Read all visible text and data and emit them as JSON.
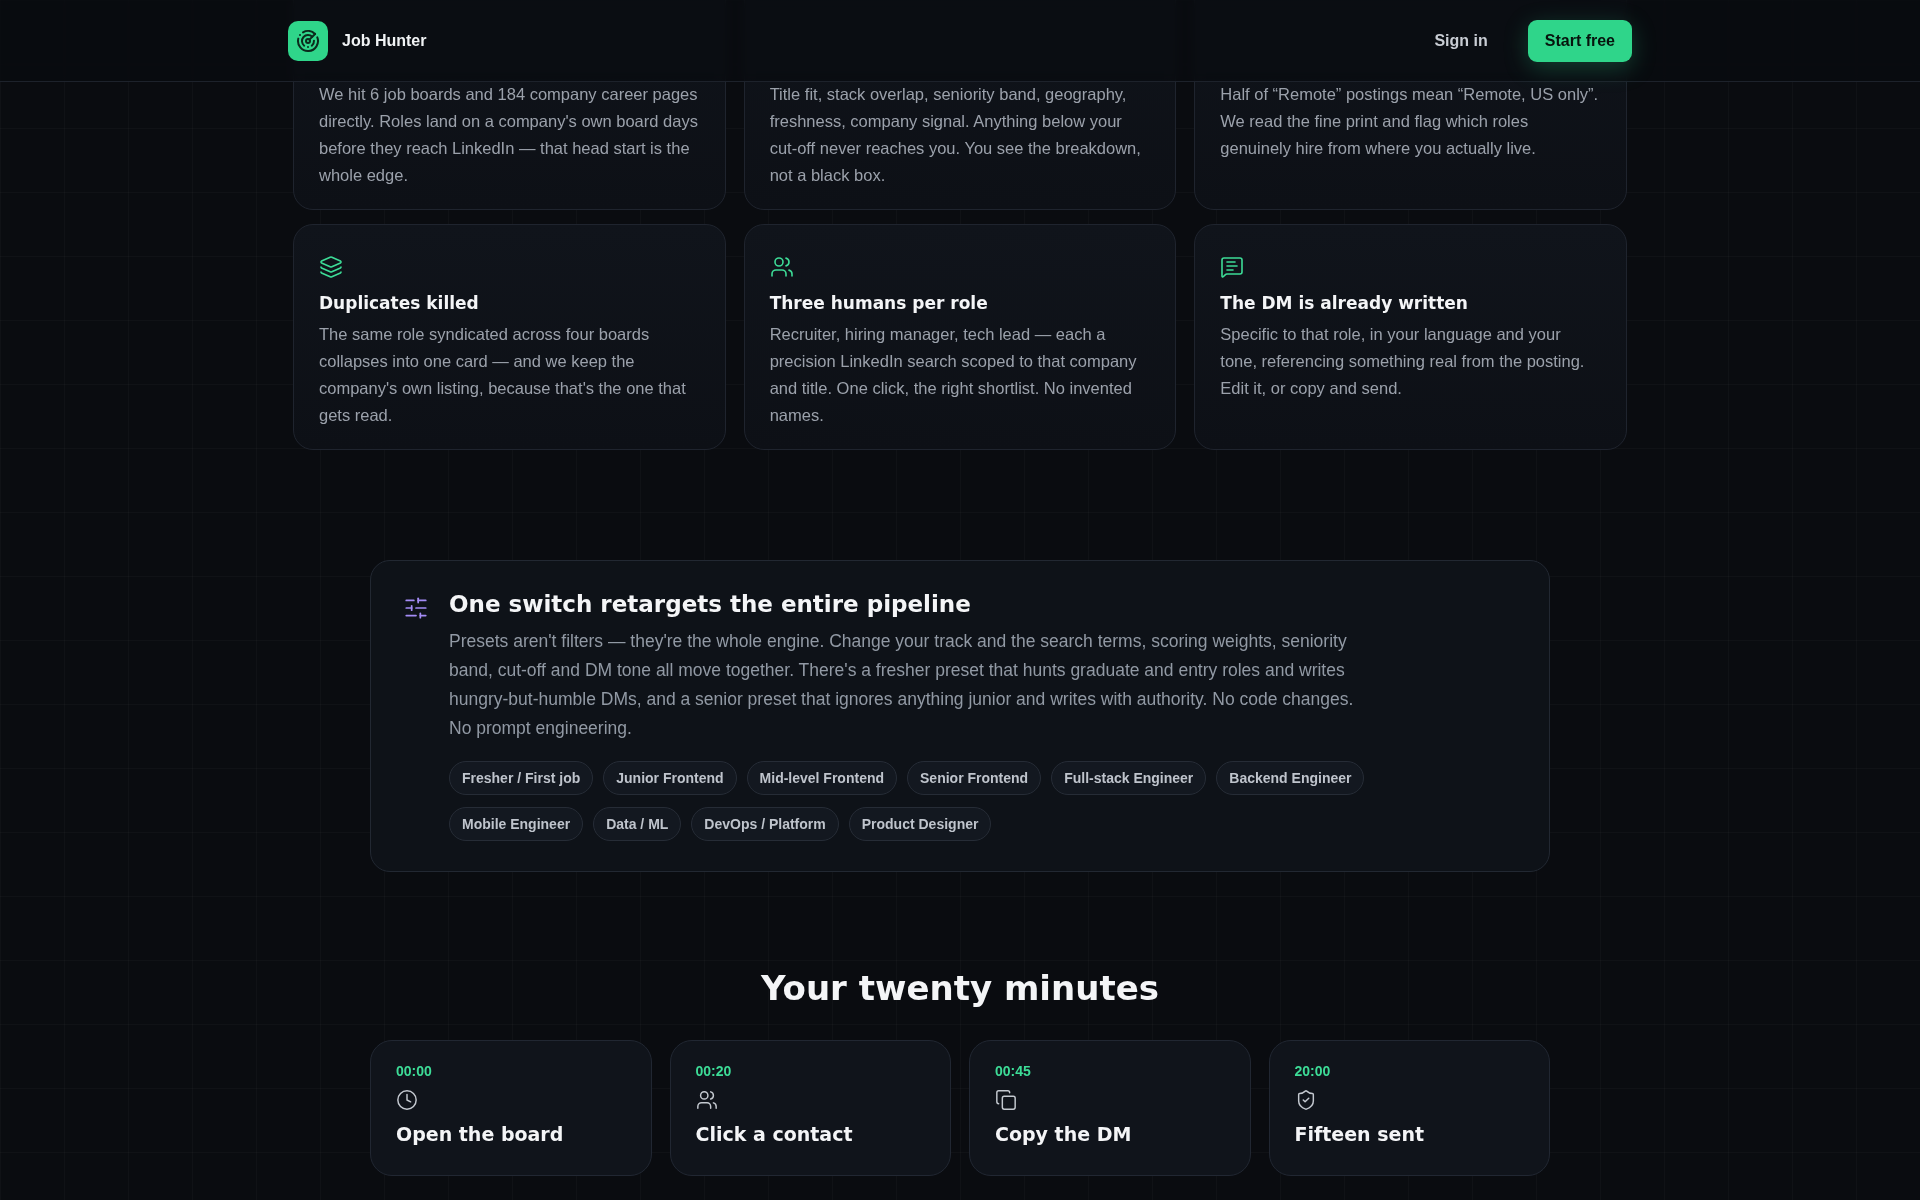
{
  "header": {
    "brand": "Job Hunter",
    "sign_in": "Sign in",
    "cta": "Start free"
  },
  "features_top": [
    {
      "body": "We hit 6 job boards and 184 company career pages directly. Roles land on a company's own board days before they reach LinkedIn — that head start is the whole edge."
    },
    {
      "body": "Title fit, stack overlap, seniority band, geography, freshness, company signal. Anything below your cut-off never reaches you. You see the breakdown, not a black box."
    },
    {
      "body": "Half of “Remote” postings mean “Remote, US only”. We read the fine print and flag which roles genuinely hire from where you actually live."
    }
  ],
  "features": [
    {
      "title": "Duplicates killed",
      "body": "The same role syndicated across four boards collapses into one card — and we keep the company's own listing, because that's the one that gets read."
    },
    {
      "title": "Three humans per role",
      "body": "Recruiter, hiring manager, tech lead — each a precision LinkedIn search scoped to that company and title. One click, the right shortlist. No invented names."
    },
    {
      "title": "The DM is already written",
      "body": "Specific to that role, in your language and your tone, referencing something real from the posting. Edit it, or copy and send."
    }
  ],
  "preset_panel": {
    "title": "One switch retargets the entire pipeline",
    "body": "Presets aren't filters — they're the whole engine. Change your track and the search terms, scoring weights, seniority band, cut-off and DM tone all move together. There's a fresher preset that hunts graduate and entry roles and writes hungry-but-humble DMs, and a senior preset that ignores anything junior and writes with authority. No code changes. No prompt engineering.",
    "presets": [
      "Fresher / First job",
      "Junior Frontend",
      "Mid-level Frontend",
      "Senior Frontend",
      "Full-stack Engineer",
      "Backend Engineer",
      "Mobile Engineer",
      "Data / ML",
      "DevOps / Platform",
      "Product Designer"
    ]
  },
  "timeline": {
    "title": "Your twenty minutes",
    "steps": [
      {
        "time": "00:00",
        "title": "Open the board"
      },
      {
        "time": "00:20",
        "title": "Click a contact"
      },
      {
        "time": "00:45",
        "title": "Copy the DM"
      },
      {
        "time": "20:00",
        "title": "Fifteen sent"
      }
    ]
  }
}
